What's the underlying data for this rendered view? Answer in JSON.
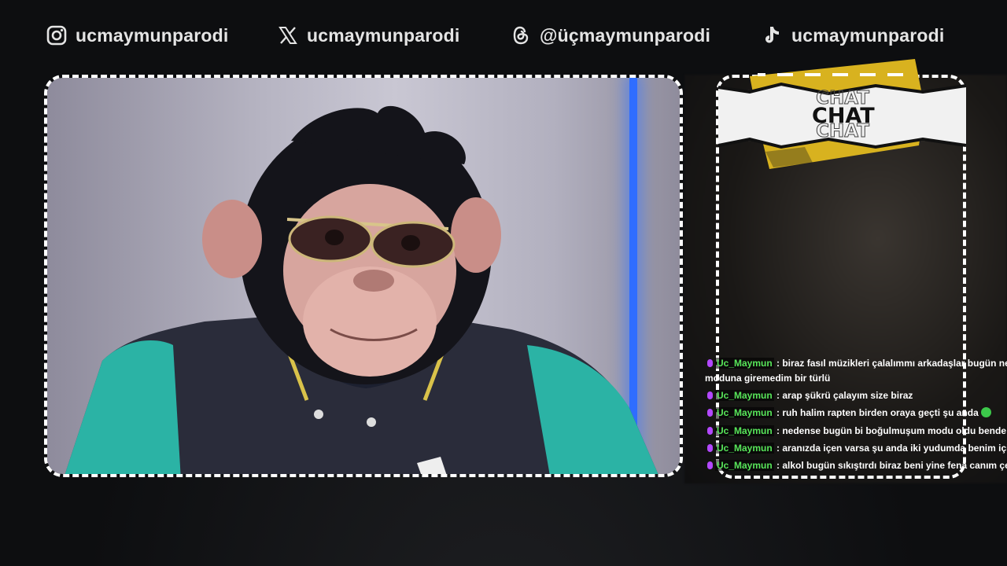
{
  "socials": [
    {
      "icon": "instagram-icon",
      "handle": "ucmaymunparodi"
    },
    {
      "icon": "x-icon",
      "handle": "ucmaymunparodi"
    },
    {
      "icon": "threads-icon",
      "handle": "@üçmaymunparodi"
    },
    {
      "icon": "tiktok-icon",
      "handle": "ucmaymunparodi"
    }
  ],
  "chat": {
    "title": "CHAT",
    "colors": {
      "username": "#58e65a",
      "mic": "#b348ff",
      "banner": "#d8b21f"
    },
    "messages": [
      {
        "user": "Uc_Maymun",
        "text": " : biraz fasıl müzikleri çalalımmı arkadaşlar bugün ne dir",
        "cont": "moduna giremedim bir türlü"
      },
      {
        "user": "Uc_Maymun",
        "text": " : arap şükrü çalayım size biraz"
      },
      {
        "user": "Uc_Maymun",
        "text": " : ruh halim rapten birden oraya geçti şu anda"
      },
      {
        "user": "Uc_Maymun",
        "text": " : nedense bugün bi boğulmuşum modu oldu bende"
      },
      {
        "user": "Uc_Maymun",
        "text": " : aranızda içen varsa şu anda iki yudumda benim için çe"
      },
      {
        "user": "Uc_Maymun",
        "text": " : alkol bugün sıkıştırdı biraz beni yine fena canım çekti"
      }
    ]
  }
}
